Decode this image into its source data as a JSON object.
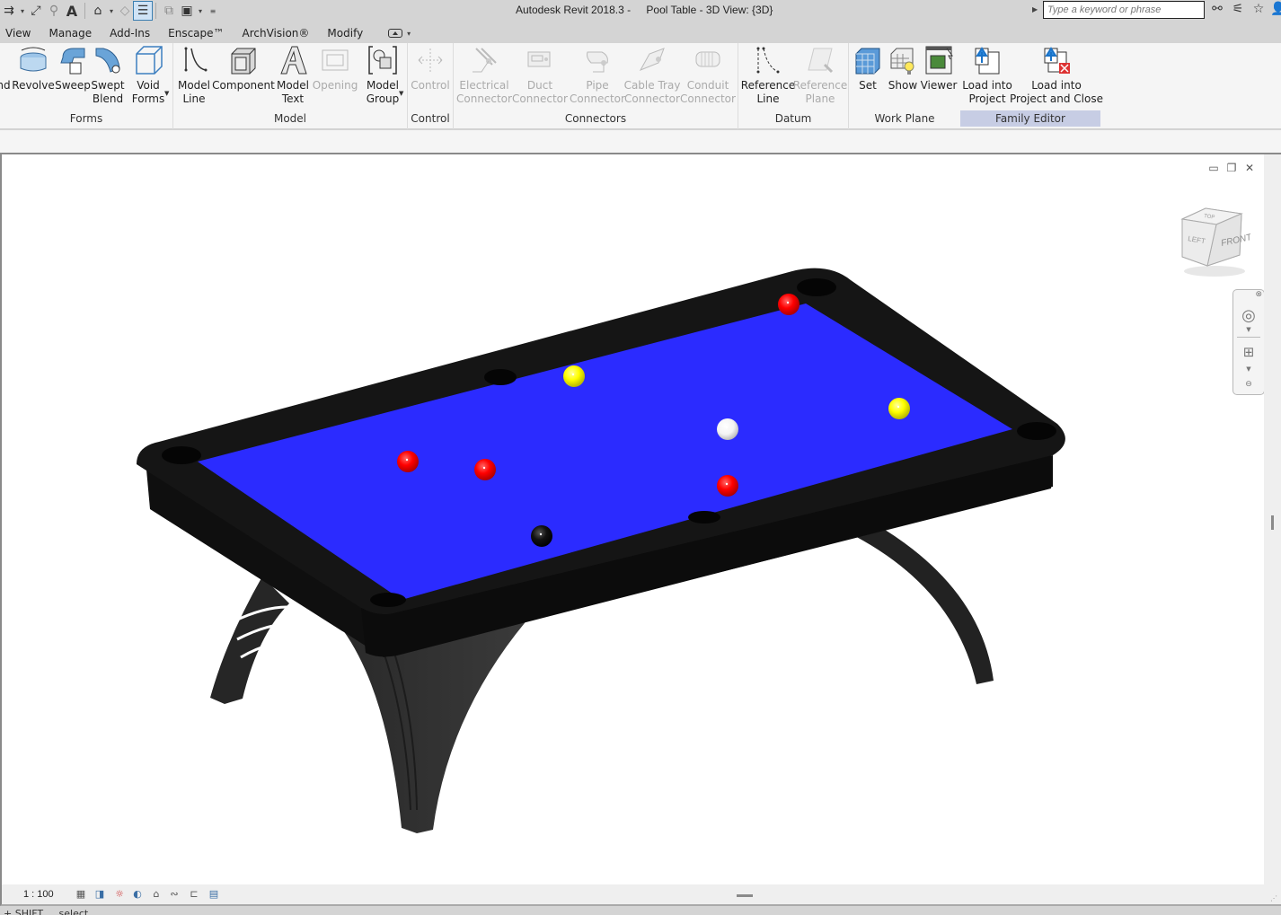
{
  "titlebar": {
    "app_name": "Autodesk Revit 2018.3 -",
    "document_title": "Pool Table - 3D View: {3D}",
    "search_placeholder": "Type a keyword or phrase",
    "qat_icons": [
      "align-dimension-icon",
      "measure-icon",
      "tag-icon",
      "text-icon",
      "default-3d-view-icon",
      "sync-icon",
      "thin-lines-icon",
      "close-hidden-windows-icon",
      "switch-windows-icon",
      "customize-qat-icon"
    ],
    "title_tools": [
      "binoculars-icon",
      "communication-center-icon",
      "favorites-star-icon",
      "user-icon"
    ]
  },
  "tabs": [
    {
      "label": "View"
    },
    {
      "label": "Manage"
    },
    {
      "label": "Add-Ins"
    },
    {
      "label": "Enscape™"
    },
    {
      "label": "ArchVision®"
    },
    {
      "label": "Modify"
    }
  ],
  "ribbon": {
    "panels": [
      {
        "title": "Forms",
        "buttons": [
          {
            "label": "nd",
            "label2": "",
            "icon": "extrusion-icon",
            "enabled": true
          },
          {
            "label": "Revolve",
            "label2": "",
            "icon": "revolve-icon",
            "enabled": true
          },
          {
            "label": "Sweep",
            "label2": "",
            "icon": "sweep-icon",
            "enabled": true
          },
          {
            "label": "Swept",
            "label2": "Blend",
            "icon": "swept-blend-icon",
            "enabled": true
          },
          {
            "label": "Void",
            "label2": "Forms",
            "icon": "void-forms-icon",
            "enabled": true
          }
        ]
      },
      {
        "title": "Model",
        "buttons": [
          {
            "label": "Model",
            "label2": "Line",
            "icon": "model-line-icon",
            "enabled": true
          },
          {
            "label": "Component",
            "label2": "",
            "icon": "component-icon",
            "enabled": true
          },
          {
            "label": "Model",
            "label2": "Text",
            "icon": "model-text-icon",
            "enabled": true
          },
          {
            "label": "Opening",
            "label2": "",
            "icon": "opening-icon",
            "enabled": false
          },
          {
            "label": "Model",
            "label2": "Group",
            "icon": "model-group-icon",
            "enabled": true
          }
        ]
      },
      {
        "title": "Control",
        "buttons": [
          {
            "label": "Control",
            "label2": "",
            "icon": "control-icon",
            "enabled": false
          }
        ]
      },
      {
        "title": "Connectors",
        "buttons": [
          {
            "label": "Electrical",
            "label2": "Connector",
            "icon": "electrical-connector-icon",
            "enabled": false
          },
          {
            "label": "Duct",
            "label2": "Connector",
            "icon": "duct-connector-icon",
            "enabled": false
          },
          {
            "label": "Pipe",
            "label2": "Connector",
            "icon": "pipe-connector-icon",
            "enabled": false
          },
          {
            "label": "Cable Tray",
            "label2": "Connector",
            "icon": "cable-tray-connector-icon",
            "enabled": false
          },
          {
            "label": "Conduit",
            "label2": "Connector",
            "icon": "conduit-connector-icon",
            "enabled": false
          }
        ]
      },
      {
        "title": "Datum",
        "buttons": [
          {
            "label": "Reference",
            "label2": "Line",
            "icon": "reference-line-icon",
            "enabled": true
          },
          {
            "label": "Reference",
            "label2": "Plane",
            "icon": "reference-plane-icon",
            "enabled": false
          }
        ]
      },
      {
        "title": "Work Plane",
        "buttons": [
          {
            "label": "Set",
            "label2": "",
            "icon": "set-work-plane-icon",
            "enabled": true
          },
          {
            "label": "Show",
            "label2": "",
            "icon": "show-work-plane-icon",
            "enabled": true
          },
          {
            "label": "Viewer",
            "label2": "",
            "icon": "work-plane-viewer-icon",
            "enabled": true
          }
        ]
      },
      {
        "title": "Family Editor",
        "buttons": [
          {
            "label": "Load into",
            "label2": "Project",
            "icon": "load-into-project-icon",
            "enabled": true
          },
          {
            "label": "Load into",
            "label2": "Project and Close",
            "icon": "load-into-project-close-icon",
            "enabled": true
          }
        ]
      }
    ]
  },
  "view": {
    "window_controls": [
      "minimize-icon",
      "restore-icon",
      "close-icon"
    ],
    "viewcube": {
      "front_label": "FRONT",
      "left_label": "LEFT",
      "top_label": "TOP"
    },
    "scene": {
      "cloth_color": "#2b2bff",
      "frame_color": "#141414",
      "balls": [
        {
          "color": "red",
          "hex": "#ff0000"
        },
        {
          "color": "yellow",
          "hex": "#ffff00"
        },
        {
          "color": "white",
          "hex": "#ffffff"
        },
        {
          "color": "yellow",
          "hex": "#ffff00"
        },
        {
          "color": "red",
          "hex": "#ff0000"
        },
        {
          "color": "red",
          "hex": "#ff0000"
        },
        {
          "color": "red",
          "hex": "#ff0000"
        },
        {
          "color": "black",
          "hex": "#000000"
        }
      ]
    }
  },
  "viewbar": {
    "scale": "1 : 100",
    "icons": [
      "detail-level-icon",
      "visual-style-icon",
      "sun-path-icon",
      "shadows-icon",
      "show-rendering-icon",
      "crop-view-icon",
      "lock-3d-view-icon",
      "temporary-hide-icon",
      "reveal-hidden-icon"
    ]
  },
  "status": {
    "text": "+ SHIFT ... select"
  }
}
